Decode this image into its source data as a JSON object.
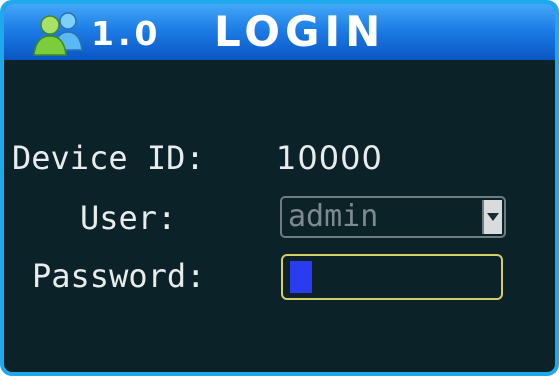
{
  "title": {
    "icon": "users-icon",
    "version": "1.0",
    "text": "LOGIN"
  },
  "form": {
    "device_id_label": "Device ID:",
    "device_id_value": "10000",
    "user_label": "User:",
    "user_value": "admin",
    "password_label": "Password:",
    "password_value": ""
  },
  "colors": {
    "frame": "#1da9ec",
    "title_bar": "#1d7de6",
    "background": "#0b2229",
    "text": "#e8ecec",
    "focus_border": "#d6cc6a",
    "cursor": "#2b3bf0"
  }
}
